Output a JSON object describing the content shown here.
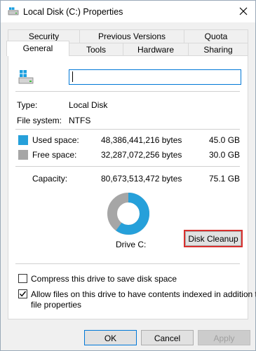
{
  "window": {
    "title": "Local Disk (C:) Properties",
    "close_icon": "close-icon"
  },
  "tabs": {
    "row1": [
      "Security",
      "Previous Versions",
      "Quota"
    ],
    "row2": [
      "General",
      "Tools",
      "Hardware",
      "Sharing"
    ],
    "active": "General"
  },
  "general": {
    "volume_name_value": "",
    "type_label": "Type:",
    "type_value": "Local Disk",
    "fs_label": "File system:",
    "fs_value": "NTFS",
    "used_label": "Used space:",
    "used_bytes": "48,386,441,216 bytes",
    "used_gb": "45.0 GB",
    "free_label": "Free space:",
    "free_bytes": "32,287,072,256 bytes",
    "free_gb": "30.0 GB",
    "capacity_label": "Capacity:",
    "capacity_bytes": "80,673,513,472 bytes",
    "capacity_gb": "75.1 GB",
    "drive_label": "Drive C:",
    "used_fraction": 0.6,
    "disk_cleanup_label": "Disk Cleanup",
    "compress_label": "Compress this drive to save disk space",
    "compress_checked": false,
    "index_label_line1": "Allow files on this drive to have contents indexed in addition to",
    "index_label_line2": "file properties",
    "index_checked": true
  },
  "colors": {
    "used": "#26a0da",
    "free": "#a6a6a6",
    "cleanup_highlight": "#d9302e"
  },
  "buttons": {
    "ok": "OK",
    "cancel": "Cancel",
    "apply": "Apply"
  }
}
